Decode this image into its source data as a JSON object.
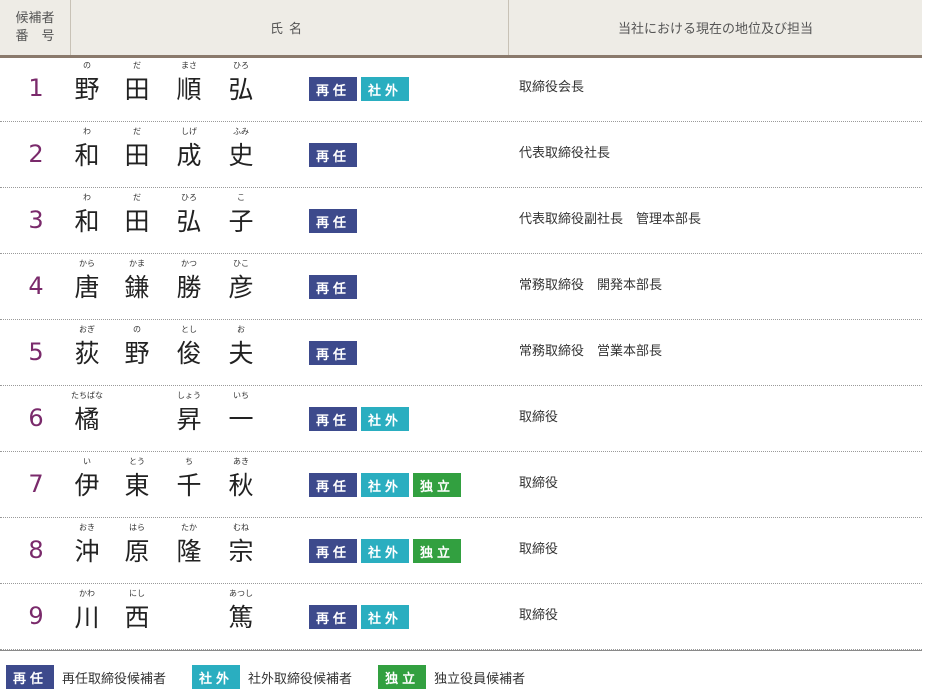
{
  "header": {
    "no_line1": "候補者",
    "no_line2": "番　号",
    "name": "氏名",
    "position": "当社における現在の地位及び担当"
  },
  "badges": {
    "reappoint": "再任",
    "outside": "社外",
    "independent": "独立"
  },
  "candidates": [
    {
      "no": "1",
      "kanji": [
        "野",
        "田",
        "順",
        "弘"
      ],
      "ruby": [
        "の",
        "だ",
        "まさ",
        "ひろ"
      ],
      "badges": [
        "reappoint",
        "outside"
      ],
      "position": "取締役会長"
    },
    {
      "no": "2",
      "kanji": [
        "和",
        "田",
        "成",
        "史"
      ],
      "ruby": [
        "わ",
        "だ",
        "しげ",
        "ふみ"
      ],
      "badges": [
        "reappoint"
      ],
      "position": "代表取締役社長"
    },
    {
      "no": "3",
      "kanji": [
        "和",
        "田",
        "弘",
        "子"
      ],
      "ruby": [
        "わ",
        "だ",
        "ひろ",
        "こ"
      ],
      "badges": [
        "reappoint"
      ],
      "position": "代表取締役副社長　管理本部長"
    },
    {
      "no": "4",
      "kanji": [
        "唐",
        "鎌",
        "勝",
        "彦"
      ],
      "ruby": [
        "から",
        "かま",
        "かつ",
        "ひこ"
      ],
      "badges": [
        "reappoint"
      ],
      "position": "常務取締役　開発本部長"
    },
    {
      "no": "5",
      "kanji": [
        "荻",
        "野",
        "俊",
        "夫"
      ],
      "ruby": [
        "おぎ",
        "の",
        "とし",
        "お"
      ],
      "badges": [
        "reappoint"
      ],
      "position": "常務取締役　営業本部長"
    },
    {
      "no": "6",
      "kanji": [
        "橘",
        "",
        "昇",
        "一"
      ],
      "ruby": [
        "たちばな",
        "",
        "しょう",
        "いち"
      ],
      "badges": [
        "reappoint",
        "outside"
      ],
      "position": "取締役"
    },
    {
      "no": "7",
      "kanji": [
        "伊",
        "東",
        "千",
        "秋"
      ],
      "ruby": [
        "い",
        "とう",
        "ち",
        "あき"
      ],
      "badges": [
        "reappoint",
        "outside",
        "independent"
      ],
      "position": "取締役"
    },
    {
      "no": "8",
      "kanji": [
        "沖",
        "原",
        "隆",
        "宗"
      ],
      "ruby": [
        "おき",
        "はら",
        "たか",
        "むね"
      ],
      "badges": [
        "reappoint",
        "outside",
        "independent"
      ],
      "position": "取締役"
    },
    {
      "no": "9",
      "kanji": [
        "川",
        "西",
        "",
        "篤"
      ],
      "ruby": [
        "かわ",
        "にし",
        "",
        "あつし"
      ],
      "badges": [
        "reappoint",
        "outside"
      ],
      "position": "取締役"
    }
  ],
  "legend": [
    {
      "badge": "reappoint",
      "text": "再任取締役候補者"
    },
    {
      "badge": "outside",
      "text": "社外取締役候補者"
    },
    {
      "badge": "independent",
      "text": "独立役員候補者"
    }
  ],
  "colors": {
    "reappoint": "#3d4a8c",
    "outside": "#2aaec0",
    "independent": "#32a040",
    "number": "#7a2a6b"
  }
}
